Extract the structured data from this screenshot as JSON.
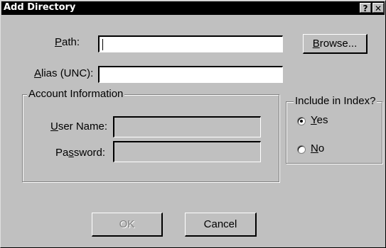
{
  "window": {
    "title": "Add Directory",
    "help_label": "?",
    "close_label": "✕"
  },
  "path": {
    "label_mnemonic": "P",
    "label_rest": "ath:",
    "value": ""
  },
  "alias": {
    "label_mnemonic": "A",
    "label_rest": "lias (UNC):",
    "value": ""
  },
  "browse_button": {
    "label_mnemonic": "B",
    "label_rest": "rowse..."
  },
  "account_information": {
    "title": "Account Information",
    "user_name": {
      "label_mnemonic": "U",
      "label_rest": "ser Name:",
      "value": ""
    },
    "password": {
      "label_pre": "Pa",
      "label_mnemonic": "s",
      "label_rest": "sword:",
      "value": ""
    }
  },
  "include_in_index": {
    "title": "Include in Index?",
    "options": [
      {
        "label_mnemonic": "Y",
        "label_rest": "es",
        "checked": true
      },
      {
        "label_mnemonic": "N",
        "label_rest": "o",
        "checked": false
      }
    ]
  },
  "buttons": {
    "ok": "OK",
    "cancel": "Cancel"
  }
}
